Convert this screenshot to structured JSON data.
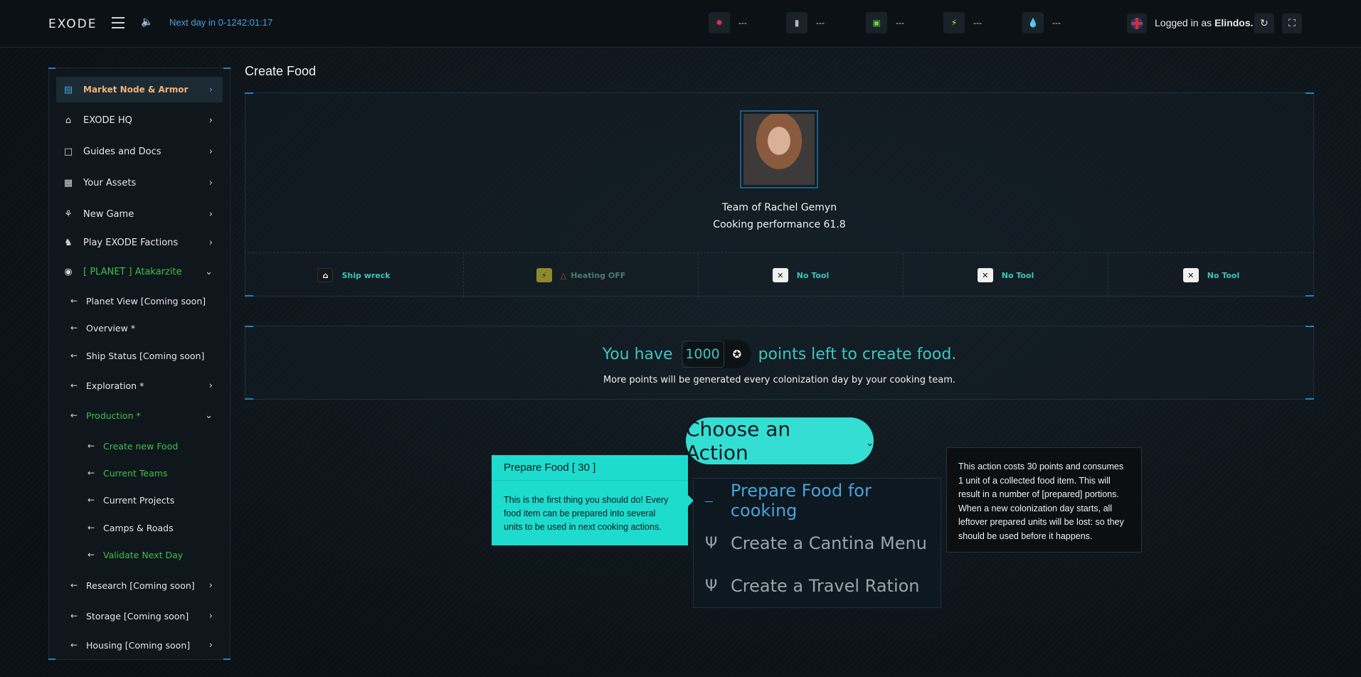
{
  "topbar": {
    "logo": "EXODE",
    "next_day": "Next day in 0-1242:01:17",
    "resources": [
      {
        "icon": "red-ore-icon",
        "value": "---",
        "color": "#e0344a"
      },
      {
        "icon": "steel-beam-icon",
        "value": "---",
        "color": "#b9b9b9"
      },
      {
        "icon": "green-crate-icon",
        "value": "---",
        "color": "#6bd14a"
      },
      {
        "icon": "lightning-icon",
        "value": "---",
        "color": "#f5d33a"
      },
      {
        "icon": "water-drop-icon",
        "value": "---",
        "color": "#4aa3d9"
      }
    ],
    "logged_prefix": "Logged in as",
    "username": "Elindos."
  },
  "sidebar": {
    "items": [
      {
        "label": "Market Node & Armor",
        "icon": "bar-chart-icon"
      },
      {
        "label": "EXODE HQ",
        "icon": "home-icon"
      },
      {
        "label": "Guides and Docs",
        "icon": "document-icon"
      },
      {
        "label": "Your Assets",
        "icon": "grid-icon"
      },
      {
        "label": "New Game",
        "icon": "joystick-icon"
      },
      {
        "label": "Play EXODE Factions",
        "icon": "factions-icon"
      },
      {
        "label": "[ PLANET ] Atakarzite",
        "icon": "planet-icon"
      }
    ],
    "planet_sub": [
      {
        "label": "Planet View [Coming soon]"
      },
      {
        "label": "Overview *"
      },
      {
        "label": "Ship Status [Coming soon]"
      },
      {
        "label": "Exploration *"
      },
      {
        "label": "Production *"
      }
    ],
    "production_sub": [
      {
        "label": "Create new Food"
      },
      {
        "label": "Current Teams"
      },
      {
        "label": "Current Projects"
      },
      {
        "label": "Camps & Roads"
      },
      {
        "label": "Validate Next Day"
      }
    ],
    "planet_sub_after": [
      {
        "label": "Research [Coming soon]"
      },
      {
        "label": "Storage [Coming soon]"
      },
      {
        "label": "Housing [Coming soon]"
      }
    ]
  },
  "main": {
    "title": "Create Food",
    "team_name": "Team of Rachel Gemyn",
    "performance": "Cooking performance 61.8",
    "slots": [
      {
        "icon": "ship-icon",
        "label": "Ship wreck"
      },
      {
        "icon": "lightning-icon",
        "label": "Heating OFF"
      },
      {
        "icon": "tool-icon",
        "label": "No Tool"
      },
      {
        "icon": "tool-icon",
        "label": "No Tool"
      },
      {
        "icon": "tool-icon",
        "label": "No Tool"
      }
    ],
    "points_prefix": "You have",
    "points_value": "1000",
    "points_suffix": "points left to create food.",
    "points_sub": "More points will be generated every colonization day by your cooking team.",
    "choose_label": "Choose an Action",
    "actions": [
      {
        "icon": "knife-icon",
        "label": "Prepare Food for cooking"
      },
      {
        "icon": "fork-knife-icon",
        "label": "Create a Cantina Menu"
      },
      {
        "icon": "fork-knife-icon",
        "label": "Create a Travel Ration"
      }
    ],
    "tooltip_left": {
      "title": "Prepare Food [ 30 ]",
      "body": "This is the first thing you should do! Every food item can be prepared into several units to be used in next cooking actions."
    },
    "tooltip_right": "This action costs 30 points and consumes 1 unit of a collected food item. This will result in a number of [prepared] portions. When a new colonization day starts, all leftover prepared units will be lost: so they should be used before it happens."
  }
}
